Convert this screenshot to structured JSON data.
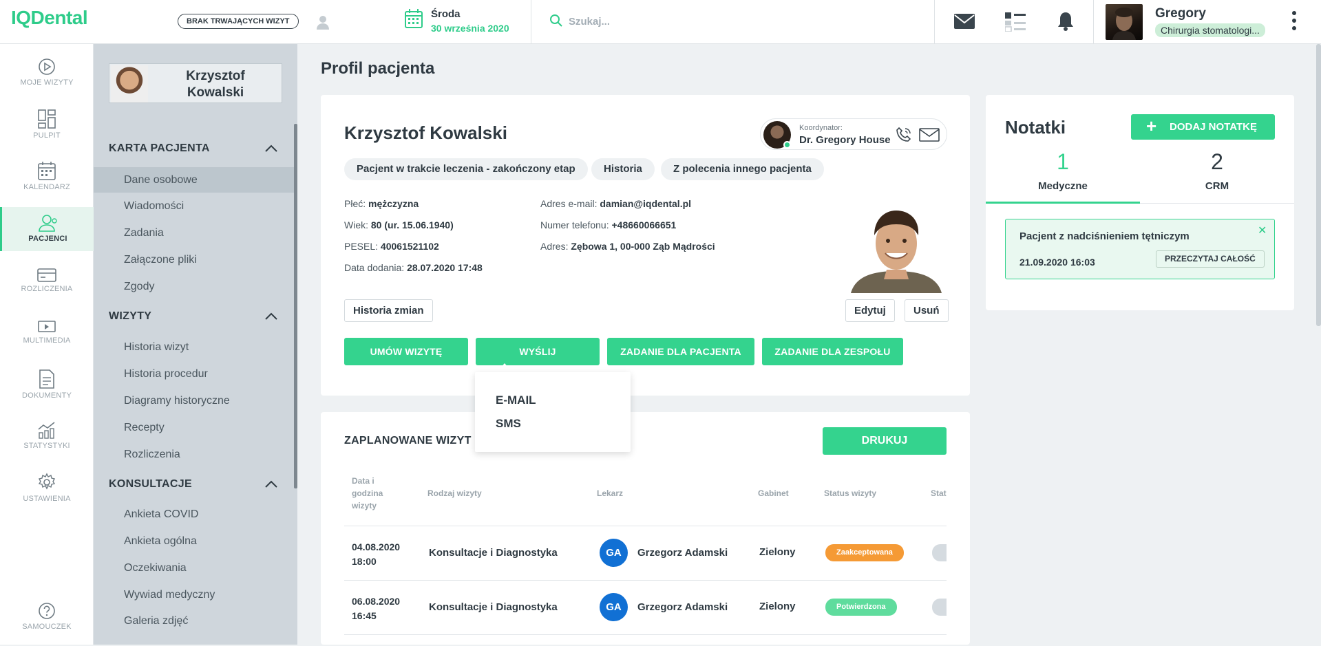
{
  "app": {
    "logo": "IQDental"
  },
  "topbar": {
    "visit_status": "BRAK TRWAJĄCYCH WIZYT",
    "date_day": "Środa",
    "date_full": "30 września 2020",
    "search_placeholder": "Szukaj...",
    "user_name": "Gregory",
    "user_role": "Chirurgia stomatologi..."
  },
  "leftnav": {
    "items": [
      {
        "label": "MOJE WIZYTY",
        "icon": "play-circle-icon"
      },
      {
        "label": "PULPIT",
        "icon": "dashboard-icon"
      },
      {
        "label": "KALENDARZ",
        "icon": "calendar-icon"
      },
      {
        "label": "PACJENCI",
        "icon": "patients-icon",
        "active": true
      },
      {
        "label": "ROZLICZENIA",
        "icon": "credit-card-icon"
      },
      {
        "label": "MULTIMEDIA",
        "icon": "multimedia-icon"
      },
      {
        "label": "DOKUMENTY",
        "icon": "document-icon"
      },
      {
        "label": "STATYSTYKI",
        "icon": "stats-icon"
      },
      {
        "label": "USTAWIENIA",
        "icon": "settings-icon"
      }
    ],
    "help": {
      "label": "SAMOUCZEK",
      "icon": "help-icon"
    }
  },
  "subnav": {
    "patient_name_line1": "Krzysztof",
    "patient_name_line2": "Kowalski",
    "sections": [
      {
        "title": "KARTA PACJENTA",
        "items": [
          "Dane osobowe",
          "Wiadomości",
          "Zadania",
          "Załączone pliki",
          "Zgody"
        ]
      },
      {
        "title": "WIZYTY",
        "items": [
          "Historia wizyt",
          "Historia procedur",
          "Diagramy historyczne",
          "Recepty",
          "Rozliczenia"
        ]
      },
      {
        "title": "KONSULTACJE",
        "items": [
          "Ankieta COVID",
          "Ankieta ogólna",
          "Oczekiwania",
          "Wywiad medyczny",
          "Galeria zdjęć"
        ]
      }
    ],
    "selected": "Dane osobowe"
  },
  "main": {
    "page_title": "Profil pacjenta",
    "patient": {
      "name": "Krzysztof Kowalski",
      "coordinator_label": "Koordynator:",
      "coordinator_name": "Dr. Gregory House",
      "tags": [
        "Pacjent w trakcie leczenia - zakończony etap",
        "Historia",
        "Z polecenia innego pacjenta"
      ],
      "gender_label": "Płeć:",
      "gender": "mężczyzna",
      "age_label": "Wiek:",
      "age": "80 (ur. 15.06.1940)",
      "pesel_label": "PESEL:",
      "pesel": "40061521102",
      "added_label": "Data dodania:",
      "added": "28.07.2020 17:48",
      "email_label": "Adres e-mail:",
      "email": "damian@iqdental.pl",
      "phone_label": "Numer telefonu:",
      "phone": "+48660066651",
      "address_label": "Adres:",
      "address": "Zębowa 1, 00-000 Ząb Mądrości"
    },
    "buttons": {
      "history": "Historia zmian",
      "edit": "Edytuj",
      "delete": "Usuń",
      "book": "UMÓW WIZYTĘ",
      "send": "WYŚLIJ",
      "task_patient": "ZADANIE DLA PACJENTA",
      "task_team": "ZADANIE DLA ZESPOŁU"
    },
    "send_menu": [
      "E-MAIL",
      "SMS"
    ],
    "schedule": {
      "title": "ZAPLANOWANE WIZYT",
      "print": "DRUKUJ",
      "headers": [
        "Data i godzina wizyty",
        "Rodzaj wizyty",
        "Lekarz",
        "Gabinet",
        "Status wizyty",
        "Stat"
      ],
      "rows": [
        {
          "date": "04.08.2020",
          "time": "18:00",
          "type": "Konsultacje i Diagnostyka",
          "initials": "GA",
          "doctor": "Grzegorz Adamski",
          "room": "Zielony",
          "status": "Zaakceptowana",
          "status_color": "#f59a35"
        },
        {
          "date": "06.08.2020",
          "time": "16:45",
          "type": "Konsultacje i Diagnostyka",
          "initials": "GA",
          "doctor": "Grzegorz Adamski",
          "room": "Zielony",
          "status": "Potwierdzona",
          "status_color": "#5fdc9d"
        }
      ]
    }
  },
  "notes": {
    "title": "Notatki",
    "add": "DODAJ NOTATKĘ",
    "tabs": [
      {
        "count": "1",
        "label": "Medyczne",
        "active": true
      },
      {
        "count": "2",
        "label": "CRM"
      }
    ],
    "note": {
      "text": "Pacjent z nadciśnieniem tętniczym",
      "date": "21.09.2020 16:03",
      "read": "PRZECZYTAJ CAŁOŚĆ"
    }
  },
  "colors": {
    "accent": "#34d38e",
    "logo": "#2ecc8a",
    "avatar_blue": "#1170d4"
  }
}
